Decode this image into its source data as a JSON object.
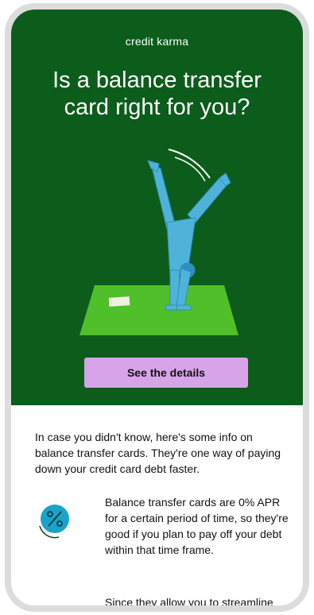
{
  "brand": "credit karma",
  "hero": {
    "headline": "Is a balance transfer card right for you?",
    "cta_label": "See the details"
  },
  "intro": "In case you didn't know, here's some info on balance transfer cards. They're one way of paying down your credit card debt faster.",
  "items": [
    {
      "icon": "percent-icon",
      "text": "Balance transfer cards are 0% APR for a certain period of time, so they're good if you plan to pay off your debt within that time frame."
    },
    {
      "icon": "green-circle-icon",
      "text": "Since they allow you to streamline"
    }
  ],
  "colors": {
    "hero_background": "#0c5c1b",
    "cta_background": "#d8a4e8",
    "mat": "#4fbf2a",
    "figure": "#4fb3d9"
  }
}
